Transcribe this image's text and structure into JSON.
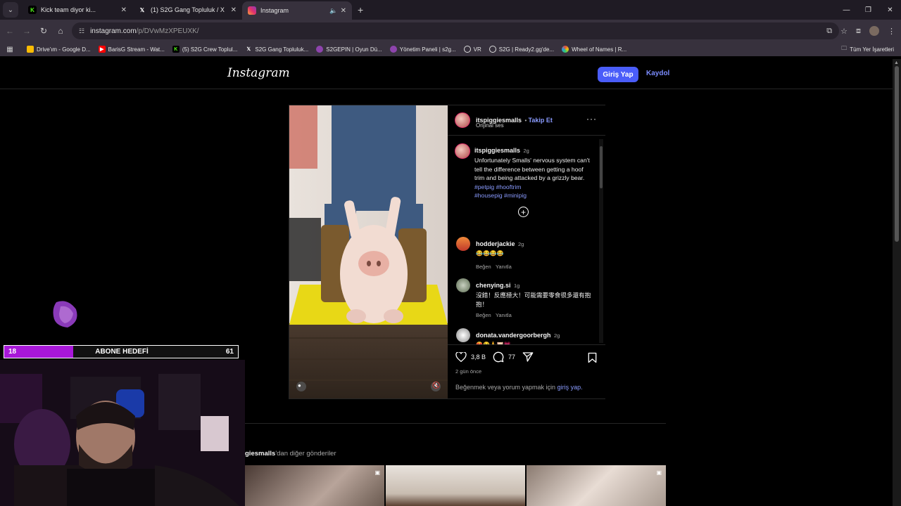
{
  "browser": {
    "tabs": [
      {
        "title": "Kick team diyor ki...",
        "icon": "kick-icon",
        "color": "#53fc18"
      },
      {
        "title": "(1) S2G Gang Topluluk / X",
        "icon": "x-icon",
        "color": "#ffffff"
      },
      {
        "title": "Instagram",
        "icon": "instagram-icon",
        "color": "#e1306c",
        "active": true
      }
    ],
    "url_host": "instagram.com",
    "url_path": "/p/DVwMzXPEUXK/",
    "bookmarks": [
      {
        "label": "Drive'ım - Google D...",
        "icon": "drive-icon",
        "color": "#fbbc04"
      },
      {
        "label": "BarisG Stream - Wat...",
        "icon": "youtube-icon",
        "color": "#ff0000"
      },
      {
        "label": "(5) S2G Crew Toplul...",
        "icon": "kick-icon",
        "color": "#53fc18"
      },
      {
        "label": "S2G Gang Topluluk...",
        "icon": "x-icon",
        "color": "#ffffff"
      },
      {
        "label": "S2GEPIN | Oyun Dü...",
        "icon": "s2g-icon",
        "color": "#8e44ad"
      },
      {
        "label": "Yönetim Paneli | s2g...",
        "icon": "s2g-icon",
        "color": "#8e44ad"
      },
      {
        "label": "VR",
        "icon": "vr-icon",
        "color": "#dddddd"
      },
      {
        "label": "S2G | Ready2.gg'de...",
        "icon": "globe-icon",
        "color": "#dddddd"
      },
      {
        "label": "Wheel of Names | R...",
        "icon": "wheel-icon",
        "color": "#e74c3c"
      }
    ],
    "all_bookmarks": "Tüm Yer İşaretleri"
  },
  "instagram": {
    "logo": "Instagram",
    "login_label": "Giriş Yap",
    "signup_label": "Kaydol",
    "post": {
      "author": "itspiggiesmalls",
      "follow": "Takip Et",
      "audio": "Orijinal ses",
      "caption_author": "itspiggiesmalls",
      "caption_time": "2g",
      "caption": "Unfortunately Smalls' nervous system can't tell the difference between getting a hoof trim and being attacked by a grizzly bear.",
      "hashtags1": "#petpig #hooftrim",
      "hashtags2": "#housepig #minipig",
      "comments": [
        {
          "user": "hodderjackie",
          "time": "2g",
          "text": "😂😂😂😂",
          "like": "Beğen",
          "reply": "Yanıtla"
        },
        {
          "user": "chenying.si",
          "time": "1g",
          "text": "沒錯！反應極大！可能需要零食很多還有抱抱！",
          "like": "Beğen",
          "reply": "Yanıtla"
        },
        {
          "user": "donata.vandergoorbergh",
          "time": "2g",
          "text": "😍😂🙏🐷💗",
          "like": "",
          "reply": ""
        }
      ],
      "likes": "3,8 B",
      "comment_count": "77",
      "posted": "2 gün önce",
      "login_prompt": "Beğenmek veya yorum yapmak için",
      "login_link": "giriş yap."
    },
    "more_posts_user": "giesmalls",
    "more_posts_suffix": "'dan diğer gönderiler"
  },
  "stream": {
    "goal_current": "18",
    "goal_label": "ABONE HEDEFİ",
    "goal_target": "61",
    "goal_progress": 0.295
  }
}
